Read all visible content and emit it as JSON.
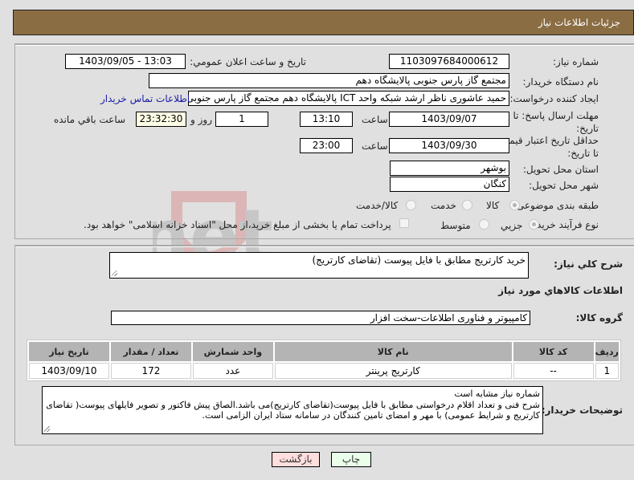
{
  "header": {
    "title": "جزئیات اطلاعات نیاز"
  },
  "form": {
    "need_number": {
      "label": "شماره نیاز:",
      "value": "1103097684000612"
    },
    "announce_datetime": {
      "label": "تاریخ و ساعت اعلان عمومي:",
      "value": "1403/09/05 - 13:03"
    },
    "buyer_org": {
      "label": "نام دستگاه خريدار:",
      "value": "مجتمع گاز پارس جنوبی  پالایشگاه دهم"
    },
    "requester": {
      "label": "ايجاد کننده درخواست:",
      "value": "حمید عاشوری ناظر ارشد شبکه واحد ICT پالایشگاه دهم مجتمع گاز پارس جنوبی",
      "contact_link": "اطلاعات تماس خریدار"
    },
    "response_deadline": {
      "label": "مهلت ارسال پاسخ: تا تاریخ:",
      "date": "1403/09/07",
      "time_label": "ساعت",
      "time": "13:10",
      "days": "1",
      "days_label": "روز و",
      "remaining": "23:32:30",
      "remaining_label": "ساعت باقي مانده"
    },
    "price_validity": {
      "label": "حداقل تاریخ اعتبار قیمت: تا تاریخ:",
      "date": "1403/09/30",
      "time_label": "ساعت",
      "time": "23:00"
    },
    "province": {
      "label": "استان محل تحويل:",
      "value": "بوشهر"
    },
    "city": {
      "label": "شهر محل تحويل:",
      "value": "کنگان"
    },
    "category": {
      "label": "طبقه بندی موضوعی:",
      "options": [
        "کالا",
        "خدمت",
        "کالا/خدمت"
      ],
      "selected": "کالا"
    },
    "purchase_type": {
      "label": "نوع فرآیند خرید :",
      "options": [
        "جزیي",
        "متوسط"
      ],
      "selected": "جزیي",
      "treasury_note": "پرداخت تمام یا بخشی از مبلغ خرید،از محل \"اسناد خزانه اسلامی\" خواهد بود."
    }
  },
  "details": {
    "summary_label": "شرح کلي نياز:",
    "summary": "خرید کارتریج مطابق با فایل پیوست (تقاضای کارتریج)",
    "goods_section_title": "اطلاعات کالاهاي مورد نياز",
    "goods_group_label": "گروه کالا:",
    "goods_group": "کامپیوتر و فناوری اطلاعات-سخت افزار",
    "table": {
      "headers": [
        "ردیف",
        "کد کالا",
        "نام کالا",
        "واحد شمارش",
        "تعداد / مقدار",
        "تاریخ نیاز"
      ],
      "rows": [
        [
          "1",
          "--",
          "کارتریج پرینتر",
          "عدد",
          "172",
          "1403/09/10"
        ]
      ]
    },
    "buyer_notes_label": "توضیحات خریدار:",
    "buyer_notes": [
      "شماره نیاز مشابه است",
      "شرح فنی و تعداد اقلام درخواستی مطابق با فایل پیوست(تقاضای کارتریج)می باشد.الصاق پیش فاکتور و تصویر فایلهای پیوست( تقاضای کارتریج و شرایط عمومی) با مهر و امضای تامین کنندگان در سامانه ستاد ایران الزامی است."
    ]
  },
  "buttons": {
    "print": "چاپ",
    "back": "بازگشت"
  },
  "watermark": {
    "text": "AriaTender.net"
  }
}
